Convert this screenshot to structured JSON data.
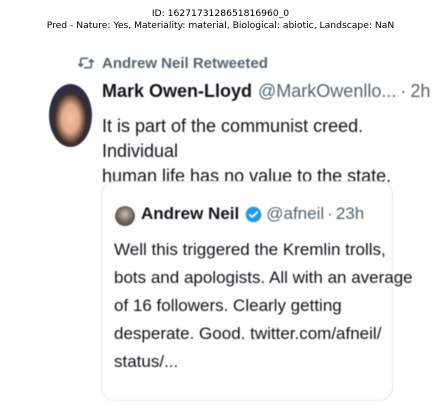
{
  "caption": {
    "line1": "ID: 1627173128651816960_0",
    "line2": "Pred - Nature: Yes, Materiality: material, Biological: abiotic, Landscape: NaN"
  },
  "retweet": {
    "icon": "retweet-icon",
    "label": "Andrew Neil Retweeted"
  },
  "tweet": {
    "author_name": "Mark Owen-Lloyd",
    "author_handle": "@MarkOwenllo...",
    "separator": "·",
    "time": "2h",
    "more_icon": "···",
    "text_lines": [
      "It is part of the communist creed. Individual",
      "human life has no value to the state."
    ]
  },
  "quote": {
    "author_name": "Andrew Neil",
    "verified_icon": "verified-badge-icon",
    "author_handle": "@afneil",
    "separator": "·",
    "time": "23h",
    "text_lines": [
      "Well this triggered the Kremlin trolls,",
      "bots and apologists. All with an average",
      "of 16 followers. Clearly getting",
      "desperate. Good. twitter.com/afneil/",
      "status/..."
    ]
  },
  "colors": {
    "text": "#0f1419",
    "secondary": "#536471",
    "verified": "#1d9bf0",
    "border": "#e1e8ed"
  }
}
